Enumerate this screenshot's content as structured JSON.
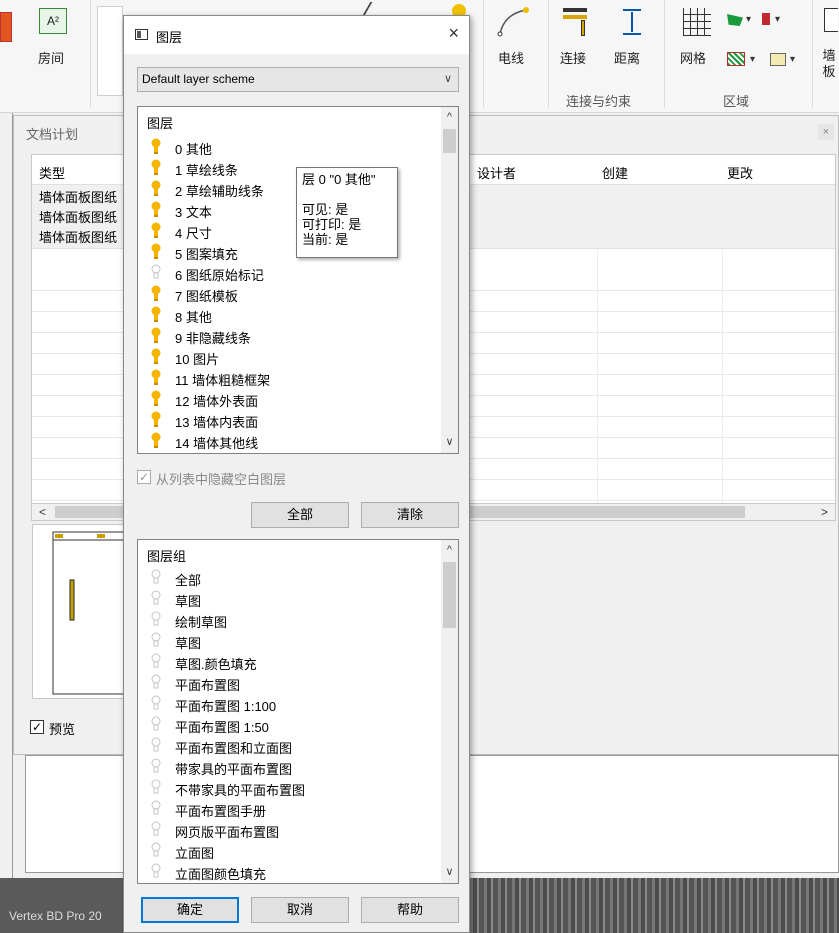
{
  "ribbon": {
    "room_label": "房间",
    "wire_label": "电线",
    "connect_label": "连接",
    "distance_label": "距离",
    "grid_label": "网格",
    "wall_label": "墙板",
    "group_connect": "连接与约束",
    "group_area": "区域",
    "room_icon_text": "A²"
  },
  "docwin": {
    "title": "文档计划",
    "columns": [
      "类型",
      "设计者",
      "创建",
      "更改"
    ],
    "rows": [
      {
        "type": "墙体面板图纸"
      },
      {
        "type": "墙体面板图纸"
      },
      {
        "type": "墙体面板图纸"
      }
    ],
    "preview_label": "预览",
    "preview_checked": true
  },
  "dialog": {
    "title": "图层",
    "scheme": "Default layer scheme",
    "layers_header": "图层",
    "layers": [
      {
        "label": "0 其他",
        "on": true
      },
      {
        "label": "1 草绘线条",
        "on": true
      },
      {
        "label": "2 草绘辅助线条",
        "on": true
      },
      {
        "label": "3 文本",
        "on": true
      },
      {
        "label": "4 尺寸",
        "on": true
      },
      {
        "label": "5 图案填充",
        "on": true
      },
      {
        "label": "6 图纸原始标记",
        "on": false
      },
      {
        "label": "7 图纸模板",
        "on": true
      },
      {
        "label": "8 其他",
        "on": true
      },
      {
        "label": "9 非隐藏线条",
        "on": true
      },
      {
        "label": "10 图片",
        "on": true
      },
      {
        "label": "11 墙体粗糙框架",
        "on": true
      },
      {
        "label": "12 墙体外表面",
        "on": true
      },
      {
        "label": "13 墙体内表面",
        "on": true
      },
      {
        "label": "14 墙体其他线",
        "on": true
      }
    ],
    "hide_empty_label": "从列表中隐藏空白图层",
    "hide_empty_checked": true,
    "all_button": "全部",
    "clear_button": "清除",
    "groups_header": "图层组",
    "groups": [
      "全部",
      "草图",
      "绘制草图",
      "草图",
      "草图.颜色填充",
      "平面布置图",
      "平面布置图 1:100",
      "平面布置图 1:50",
      "平面布置图和立面图",
      "带家具的平面布置图",
      "不带家具的平面布置图",
      "平面布置图手册",
      "网页版平面布置图",
      "立面图",
      "立面图颜色填充"
    ],
    "ok_button": "确定",
    "cancel_button": "取消",
    "help_button": "帮助",
    "tooltip": {
      "line1": "层 0 \"0 其他\"",
      "line2": "可见: 是",
      "line3": "可打印: 是",
      "line4": "当前: 是"
    }
  },
  "status": {
    "text": "Vertex BD Pro 20"
  },
  "colors": {
    "bulb_on": "#f5b400",
    "bulb_off": "#cfcfcf",
    "accent": "#0078d7"
  }
}
